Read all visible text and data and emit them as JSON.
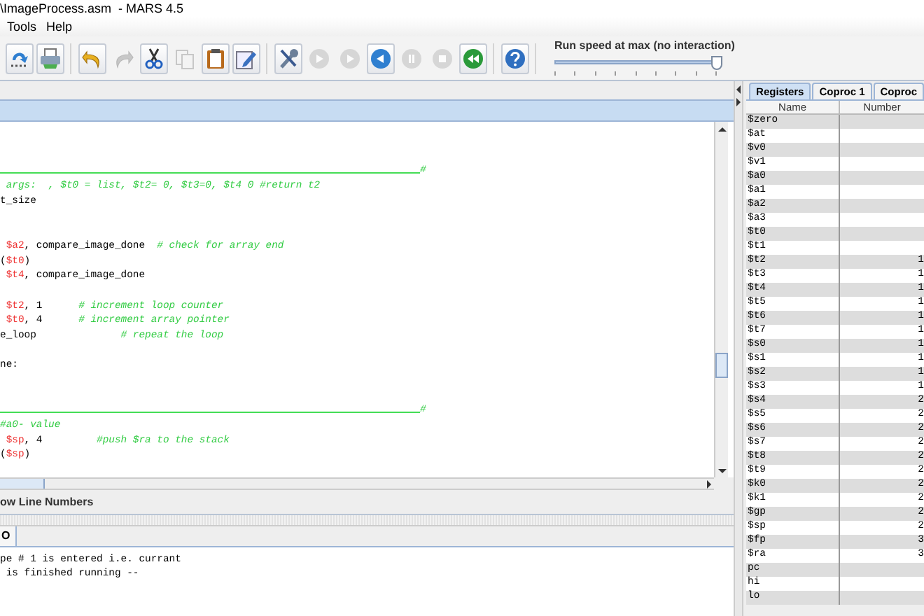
{
  "window": {
    "title": "\\ImageProcess.asm  - MARS 4.5"
  },
  "menu": [
    "Tools",
    "Help"
  ],
  "toolbar": [
    [
      {
        "kind": "assemble",
        "disabled": false
      },
      {
        "kind": "print",
        "disabled": false
      }
    ],
    [
      {
        "kind": "undo",
        "disabled": false
      },
      {
        "kind": "redo",
        "disabled": true
      },
      {
        "kind": "cut",
        "disabled": false
      },
      {
        "kind": "copy",
        "disabled": true
      },
      {
        "kind": "paste",
        "disabled": false
      },
      {
        "kind": "edit",
        "disabled": false
      }
    ],
    [
      {
        "kind": "tools",
        "disabled": false
      },
      {
        "kind": "run",
        "disabled": true
      },
      {
        "kind": "step",
        "disabled": true
      },
      {
        "kind": "backstep",
        "disabled": false
      },
      {
        "kind": "pause",
        "disabled": true
      },
      {
        "kind": "stop",
        "disabled": true
      },
      {
        "kind": "reset",
        "disabled": false
      }
    ],
    [
      {
        "kind": "help",
        "disabled": false
      }
    ]
  ],
  "speed": {
    "label": "Run speed at max (no interaction)",
    "level": 1
  },
  "editor": {
    "lines": [
      {
        "kind": "blank"
      },
      {
        "kind": "rule",
        "text": "#"
      },
      {
        "kind": "code",
        "segments": [
          {
            "kind": "comment",
            "text": " args:  , $t0 = list, $t2= 0, $t3=0, $t4 0 #return t2"
          }
        ]
      },
      {
        "kind": "code",
        "segments": [
          {
            "kind": "code",
            "text": "t_size"
          }
        ]
      },
      {
        "kind": "blank"
      },
      {
        "kind": "blank"
      },
      {
        "kind": "code",
        "segments": [
          {
            "kind": "register",
            "text": " $a2"
          },
          {
            "kind": "code",
            "text": ", compare_image_done  "
          },
          {
            "kind": "comment",
            "text": "# check for array end"
          }
        ]
      },
      {
        "kind": "code",
        "segments": [
          {
            "kind": "code",
            "text": "("
          },
          {
            "kind": "register",
            "text": "$t0"
          },
          {
            "kind": "code",
            "text": ")"
          }
        ]
      },
      {
        "kind": "code",
        "segments": [
          {
            "kind": "register",
            "text": " $t4"
          },
          {
            "kind": "code",
            "text": ", compare_image_done"
          }
        ]
      },
      {
        "kind": "blank"
      },
      {
        "kind": "code",
        "segments": [
          {
            "kind": "register",
            "text": " $t2"
          },
          {
            "kind": "code",
            "text": ", 1      "
          },
          {
            "kind": "comment",
            "text": "# increment loop counter"
          }
        ]
      },
      {
        "kind": "code",
        "segments": [
          {
            "kind": "register",
            "text": " $t0"
          },
          {
            "kind": "code",
            "text": ", 4      "
          },
          {
            "kind": "comment",
            "text": "# increment array pointer"
          }
        ]
      },
      {
        "kind": "code",
        "segments": [
          {
            "kind": "code",
            "text": "e_loop              "
          },
          {
            "kind": "comment",
            "text": "# repeat the loop"
          }
        ]
      },
      {
        "kind": "blank"
      },
      {
        "kind": "code",
        "segments": [
          {
            "kind": "code",
            "text": "ne:"
          }
        ]
      },
      {
        "kind": "blank"
      },
      {
        "kind": "blank"
      },
      {
        "kind": "rule",
        "text": "#"
      },
      {
        "kind": "code",
        "segments": [
          {
            "kind": "comment",
            "text": "#a0- value"
          }
        ]
      },
      {
        "kind": "code",
        "segments": [
          {
            "kind": "register",
            "text": " $sp"
          },
          {
            "kind": "code",
            "text": ", 4         "
          },
          {
            "kind": "comment",
            "text": "#push $ra to the stack"
          }
        ]
      },
      {
        "kind": "code",
        "segments": [
          {
            "kind": "code",
            "text": "("
          },
          {
            "kind": "register",
            "text": "$sp"
          },
          {
            "kind": "code",
            "text": ")"
          }
        ]
      }
    ]
  },
  "line_numbers_option": {
    "label": "ow Line Numbers"
  },
  "bottom_tabs": [
    {
      "label": "O",
      "selected": true
    }
  ],
  "output": [
    "pe # 1 is entered i.e. currant",
    " is finished running --"
  ],
  "register_tabs": [
    {
      "label": "Registers",
      "selected": true
    },
    {
      "label": "Coproc 1",
      "selected": false
    },
    {
      "label": "Coproc",
      "selected": false
    }
  ],
  "registers": {
    "columns": [
      "Name",
      "Number"
    ],
    "rows": [
      {
        "name": "$zero"
      },
      {
        "name": "$at"
      },
      {
        "name": "$v0"
      },
      {
        "name": "$v1"
      },
      {
        "name": "$a0"
      },
      {
        "name": "$a1"
      },
      {
        "name": "$a2"
      },
      {
        "name": "$a3"
      },
      {
        "name": "$t0"
      },
      {
        "name": "$t1"
      },
      {
        "name": "$t2",
        "number": "1"
      },
      {
        "name": "$t3",
        "number": "1"
      },
      {
        "name": "$t4",
        "number": "1"
      },
      {
        "name": "$t5",
        "number": "1"
      },
      {
        "name": "$t6",
        "number": "1"
      },
      {
        "name": "$t7",
        "number": "1"
      },
      {
        "name": "$s0",
        "number": "1"
      },
      {
        "name": "$s1",
        "number": "1"
      },
      {
        "name": "$s2",
        "number": "1"
      },
      {
        "name": "$s3",
        "number": "1"
      },
      {
        "name": "$s4",
        "number": "2"
      },
      {
        "name": "$s5",
        "number": "2"
      },
      {
        "name": "$s6",
        "number": "2"
      },
      {
        "name": "$s7",
        "number": "2"
      },
      {
        "name": "$t8",
        "number": "2"
      },
      {
        "name": "$t9",
        "number": "2"
      },
      {
        "name": "$k0",
        "number": "2"
      },
      {
        "name": "$k1",
        "number": "2"
      },
      {
        "name": "$gp",
        "number": "2"
      },
      {
        "name": "$sp",
        "number": "2"
      },
      {
        "name": "$fp",
        "number": "3"
      },
      {
        "name": "$ra",
        "number": "3"
      },
      {
        "name": "pc"
      },
      {
        "name": "hi"
      },
      {
        "name": "lo"
      }
    ]
  }
}
